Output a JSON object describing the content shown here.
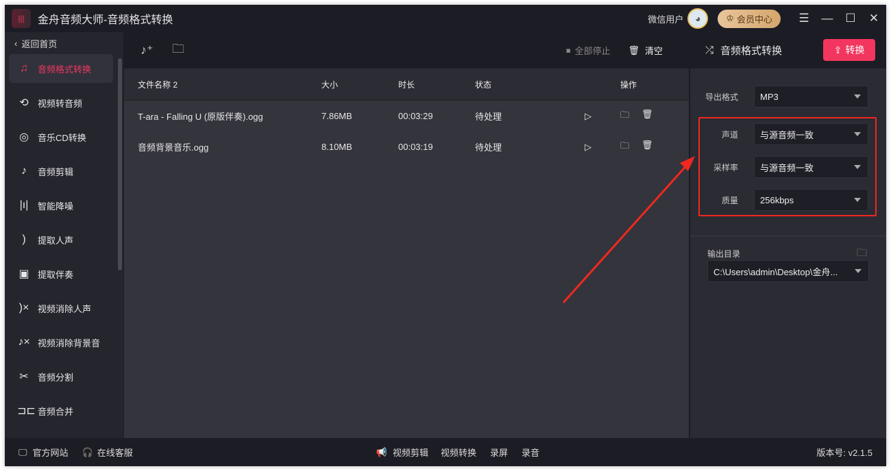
{
  "app": {
    "title": "金舟音频大师-音频格式转换",
    "user": "微信用户",
    "vip": "会员中心"
  },
  "sidebar": {
    "back": "返回首页",
    "items": [
      {
        "label": "音频格式转换",
        "icon": "audio-convert-icon"
      },
      {
        "label": "视频转音频",
        "icon": "video-to-audio-icon"
      },
      {
        "label": "音乐CD转换",
        "icon": "cd-icon"
      },
      {
        "label": "音频剪辑",
        "icon": "audio-cut-icon"
      },
      {
        "label": "智能降噪",
        "icon": "denoise-icon"
      },
      {
        "label": "提取人声",
        "icon": "voice-icon"
      },
      {
        "label": "提取伴奏",
        "icon": "accompaniment-icon"
      },
      {
        "label": "视频消除人声",
        "icon": "remove-voice-icon"
      },
      {
        "label": "视频消除背景音",
        "icon": "remove-bg-icon"
      },
      {
        "label": "音频分割",
        "icon": "split-icon"
      },
      {
        "label": "音频合并",
        "icon": "merge-icon"
      }
    ]
  },
  "toolbar": {
    "stop_all": "全部停止",
    "clear": "清空"
  },
  "table": {
    "headers": [
      "文件名称 2",
      "大小",
      "时长",
      "状态",
      "操作"
    ],
    "rows": [
      {
        "name": "T-ara - Falling U (原版伴奏).ogg",
        "size": "7.86MB",
        "duration": "00:03:29",
        "status": "待处理"
      },
      {
        "name": "音频背景音乐.ogg",
        "size": "8.10MB",
        "duration": "00:03:19",
        "status": "待处理"
      }
    ]
  },
  "panel": {
    "title": "音频格式转换",
    "convert": "转换",
    "format_label": "导出格式",
    "format": "MP3",
    "channel_label": "声道",
    "channel": "与源音频一致",
    "rate_label": "采样率",
    "rate": "与源音频一致",
    "quality_label": "质量",
    "quality": "256kbps",
    "output_label": "输出目录",
    "output": "C:\\Users\\admin\\Desktop\\金舟..."
  },
  "footer": {
    "website": "官方网站",
    "service": "在线客服",
    "links": [
      "视频剪辑",
      "视频转换",
      "录屏",
      "录音"
    ],
    "version": "版本号: v2.1.5"
  },
  "colors": {
    "accent": "#f2365f",
    "highlight": "#f0281e"
  }
}
